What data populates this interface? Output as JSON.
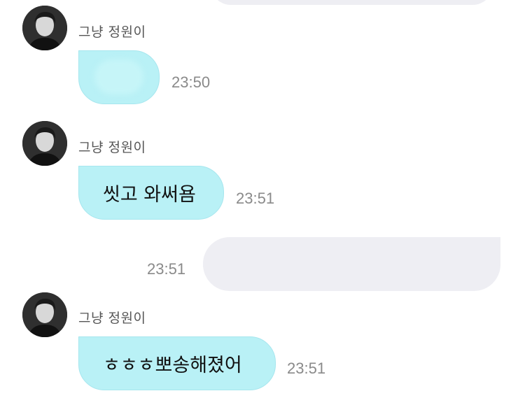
{
  "chat": {
    "messages": [
      {
        "sender": "그냥 정원이",
        "avatar_icon": "person-icon",
        "text": "",
        "time": "23:50",
        "note": "sticker/emoji bubble (blurred)"
      },
      {
        "sender": "그냥 정원이",
        "avatar_icon": "person-icon",
        "text": "씻고 와써욤",
        "time": "23:51"
      },
      {
        "outgoing": true,
        "text": "",
        "time": "23:51"
      },
      {
        "sender": "그냥 정원이",
        "avatar_icon": "person-icon",
        "text": "ㅎㅎㅎ뽀송해졌어",
        "time": "23:51"
      }
    ]
  },
  "colors": {
    "incoming_bubble": "#b9f1f6",
    "incoming_border": "#a6e6ee",
    "outgoing_bubble": "#eeeef3",
    "time_text": "#8a8a8a",
    "sender_text": "#555555"
  }
}
